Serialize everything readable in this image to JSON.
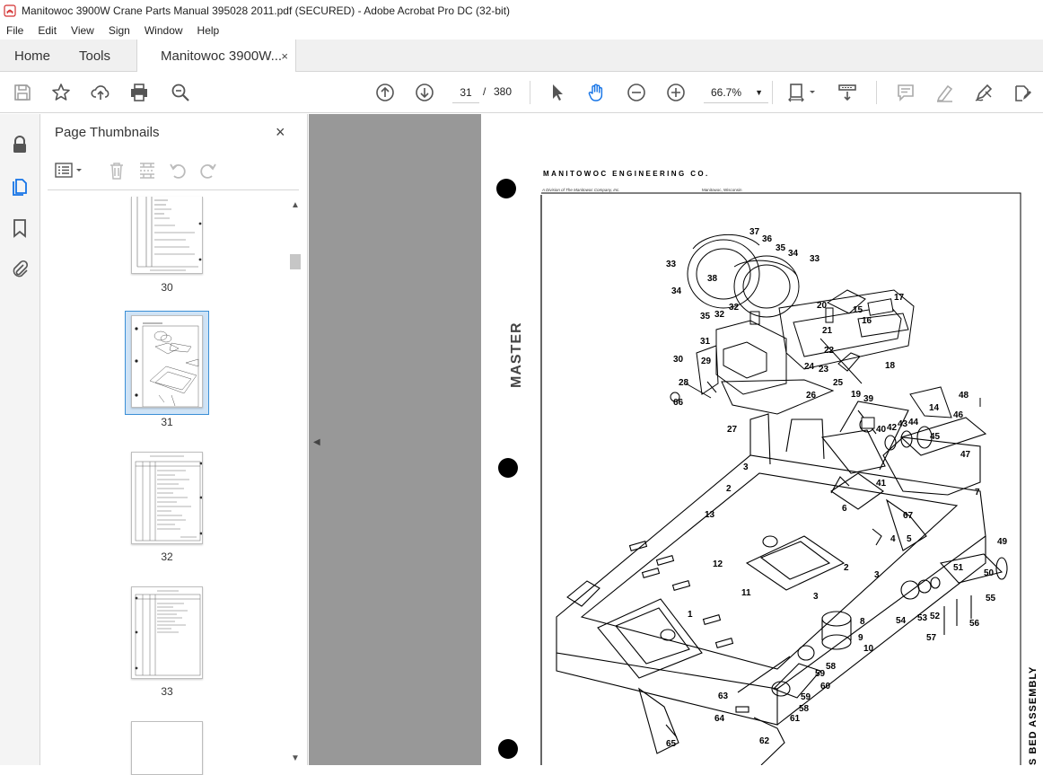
{
  "window": {
    "title": "Manitowoc 3900W Crane Parts Manual 395028 2011.pdf (SECURED) - Adobe Acrobat Pro DC (32-bit)"
  },
  "menu": [
    "File",
    "Edit",
    "View",
    "Sign",
    "Window",
    "Help"
  ],
  "tabs": {
    "home": "Home",
    "tools": "Tools",
    "document": "Manitowoc 3900W...",
    "close_glyph": "×"
  },
  "toolbar": {
    "current_page": "31",
    "page_separator": "/",
    "total_pages": "380",
    "zoom": "66.7%"
  },
  "thumbnails_panel": {
    "title": "Page Thumbnails",
    "close_glyph": "×",
    "pages": [
      {
        "label": "30"
      },
      {
        "label": "31",
        "selected": true
      },
      {
        "label": "32"
      },
      {
        "label": "33"
      }
    ]
  },
  "document": {
    "company": "MANITOWOC ENGINEERING CO.",
    "division": "A Division of The Manitowoc Company, Inc.",
    "location": "Manitowoc, Wisconsin",
    "side_stamp": "MASTER",
    "side_title": "S BED ASSEMBLY",
    "part_numbers": [
      "1",
      "2",
      "3",
      "4",
      "5",
      "6",
      "7",
      "8",
      "9",
      "10",
      "11",
      "12",
      "13",
      "14",
      "15",
      "16",
      "17",
      "18",
      "19",
      "20",
      "21",
      "22",
      "23",
      "24",
      "25",
      "26",
      "27",
      "28",
      "29",
      "30",
      "31",
      "32",
      "33",
      "34",
      "35",
      "36",
      "37",
      "38",
      "39",
      "40",
      "41",
      "42",
      "43",
      "44",
      "45",
      "46",
      "47",
      "48",
      "49",
      "50",
      "51",
      "52",
      "53",
      "54",
      "55",
      "56",
      "57",
      "58",
      "59",
      "60",
      "61",
      "62",
      "63",
      "64",
      "65",
      "66",
      "67"
    ]
  },
  "colors": {
    "accent_blue": "#3b8fd6",
    "selection_fill": "#cfe3f6",
    "doc_background": "#989898",
    "icon_gray": "#555555"
  }
}
